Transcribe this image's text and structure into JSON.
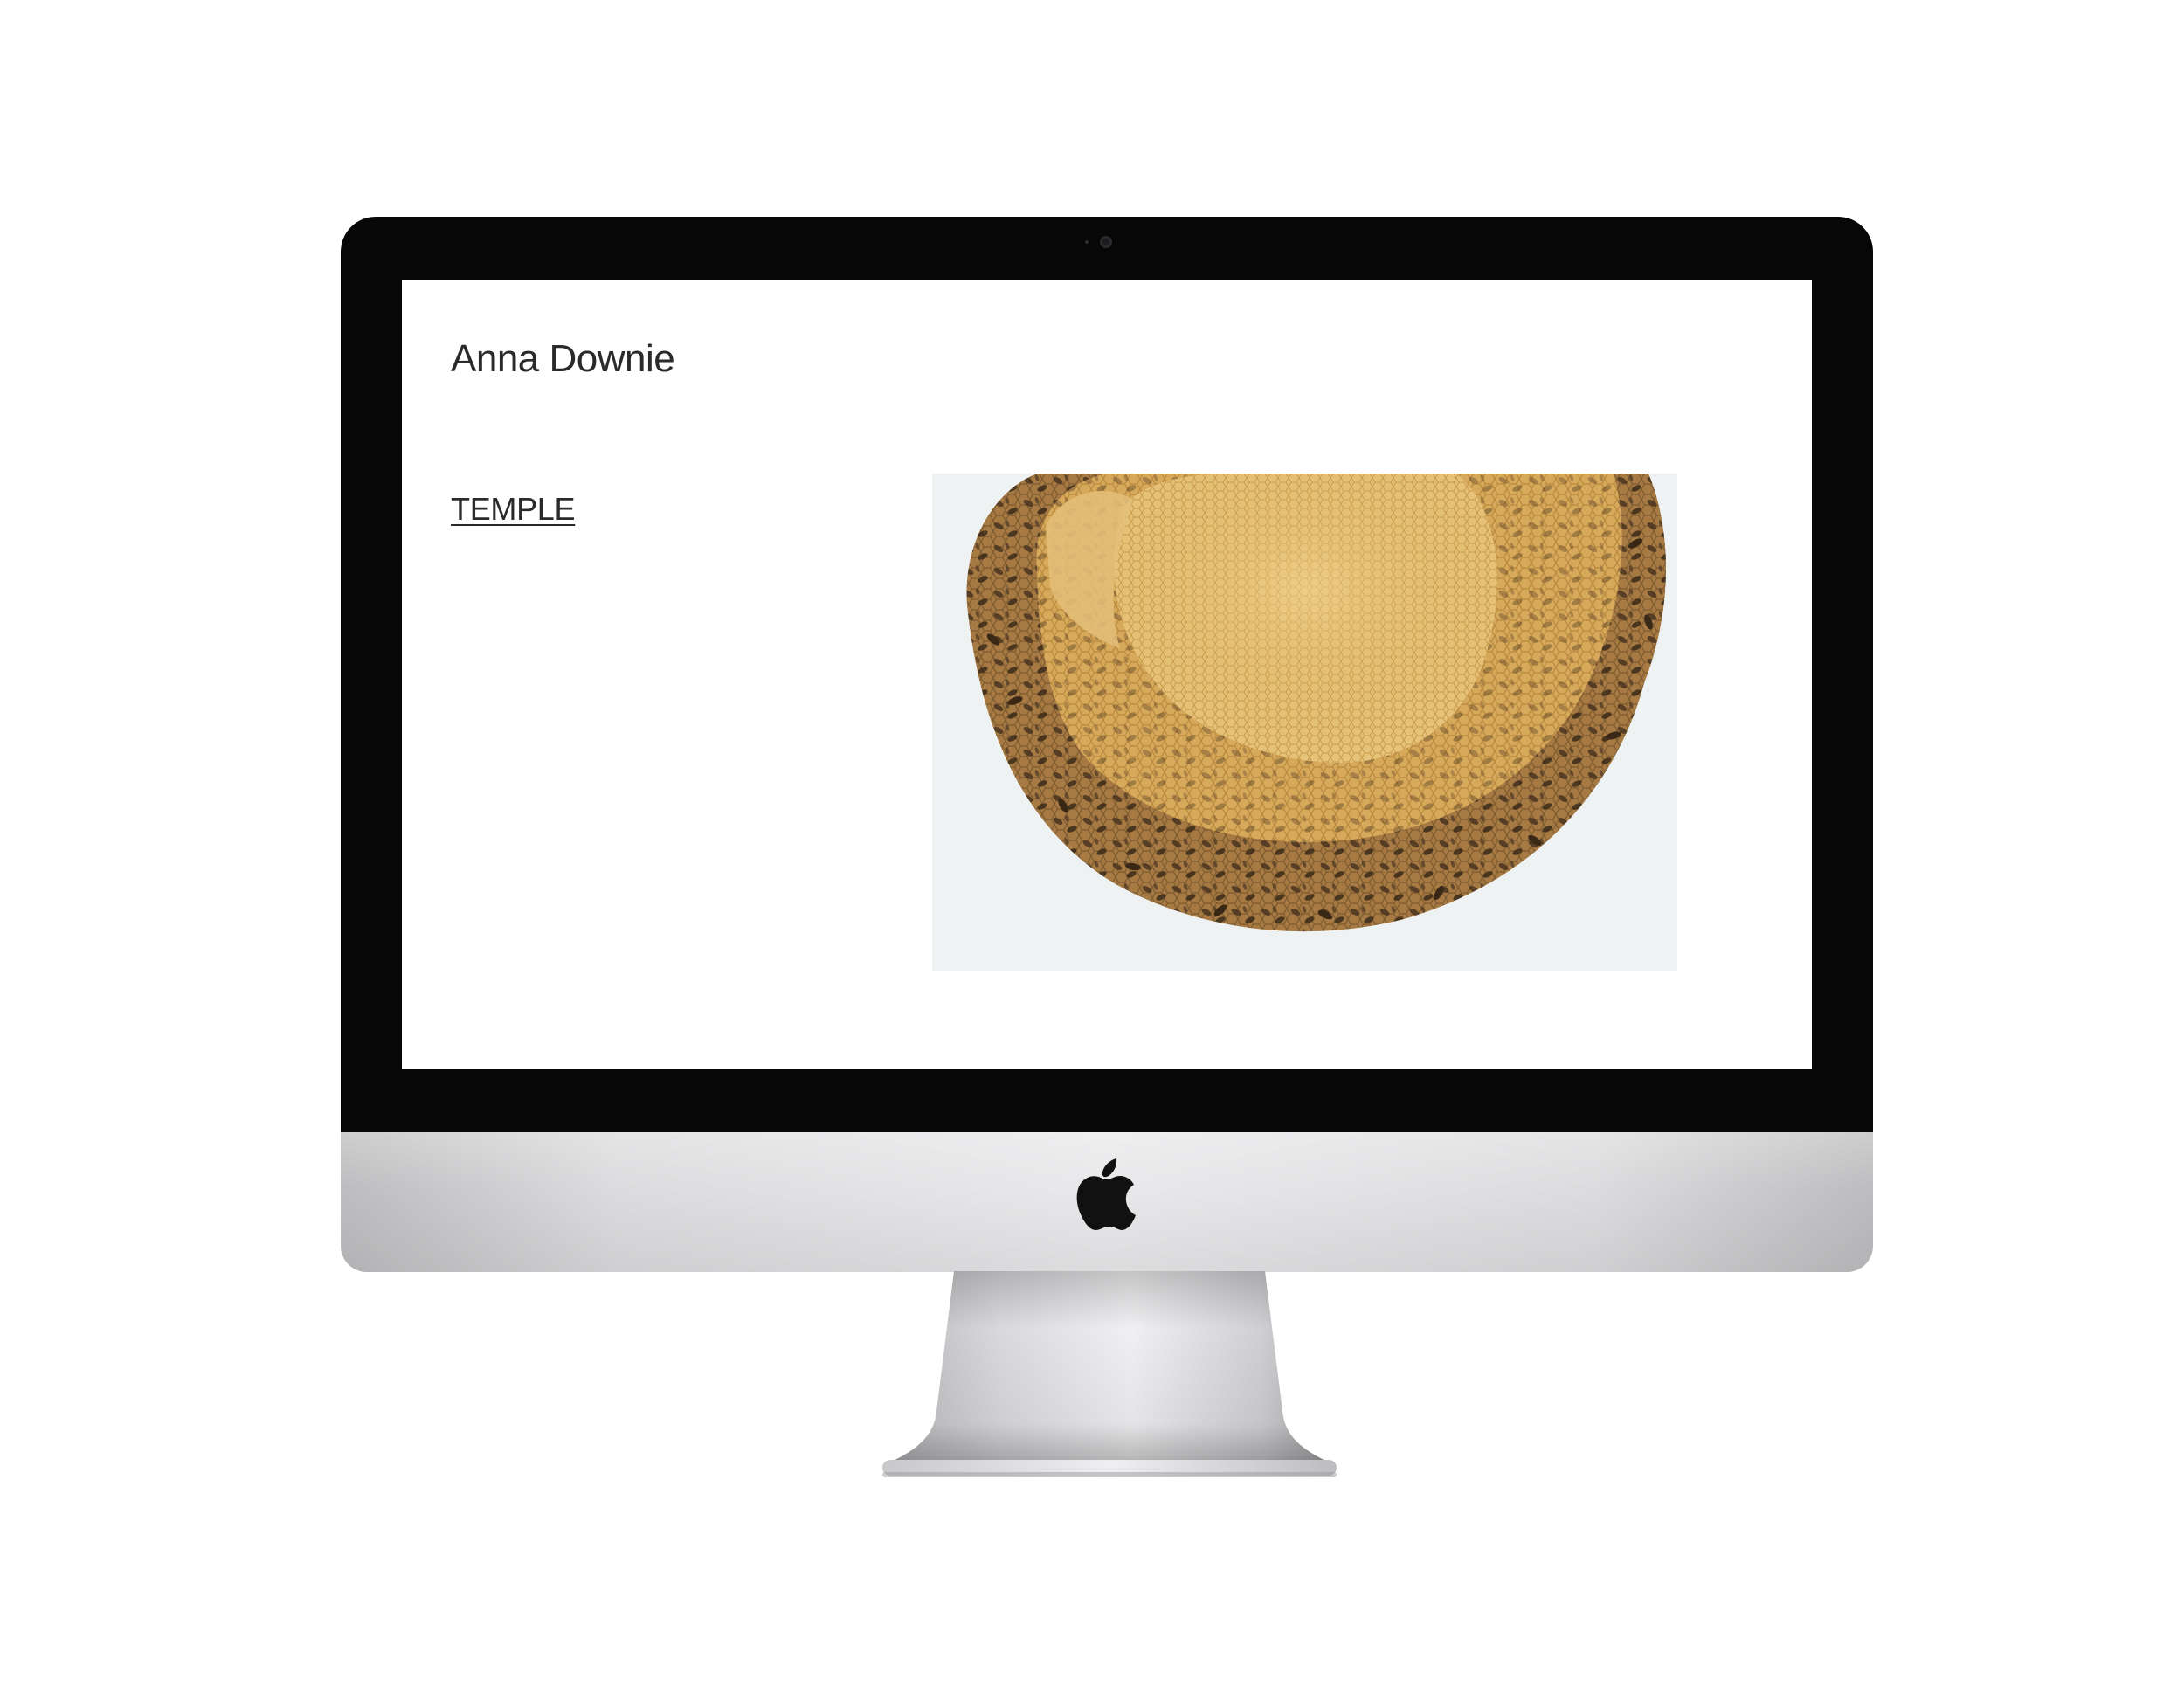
{
  "site": {
    "title": "Anna Downie",
    "project_link": "TEMPLE"
  },
  "image": {
    "subject": "honeycomb-with-bees",
    "background_color": "#eef2f3"
  },
  "device": {
    "bezel_color": "#070707",
    "chin_color": "#e1e1e3",
    "logo": "apple-icon"
  }
}
